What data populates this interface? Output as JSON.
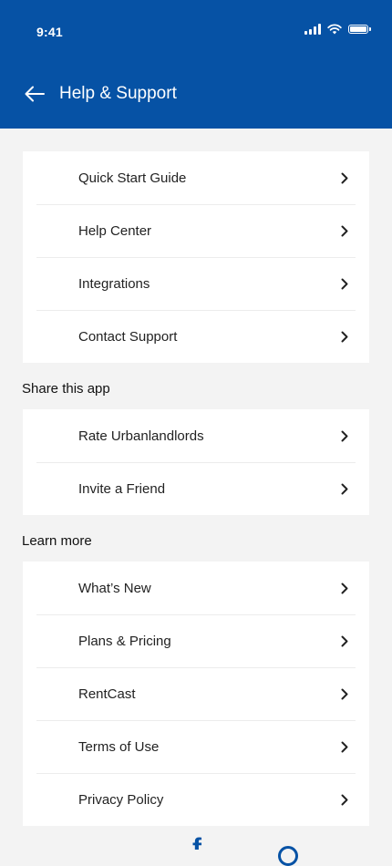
{
  "status_bar": {
    "time": "9:41"
  },
  "header": {
    "title": "Help & Support"
  },
  "groups": [
    {
      "title": "",
      "items": [
        {
          "label": "Quick Start Guide"
        },
        {
          "label": "Help Center"
        },
        {
          "label": "Integrations"
        },
        {
          "label": "Contact Support"
        }
      ]
    },
    {
      "title": "Share this app",
      "items": [
        {
          "label": "Rate Urbanlandlords"
        },
        {
          "label": "Invite a Friend"
        }
      ]
    },
    {
      "title": "Learn more",
      "items": [
        {
          "label": "What’s New"
        },
        {
          "label": "Plans & Pricing"
        },
        {
          "label": "RentCast"
        },
        {
          "label": "Terms of Use"
        },
        {
          "label": "Privacy Policy"
        }
      ]
    }
  ],
  "colors": {
    "brand": "#0652a5",
    "background": "#f3f3f3"
  },
  "icons": [
    "back-arrow-icon",
    "chevron-right-icon",
    "signal-icon",
    "wifi-icon",
    "battery-icon",
    "facebook-icon"
  ]
}
